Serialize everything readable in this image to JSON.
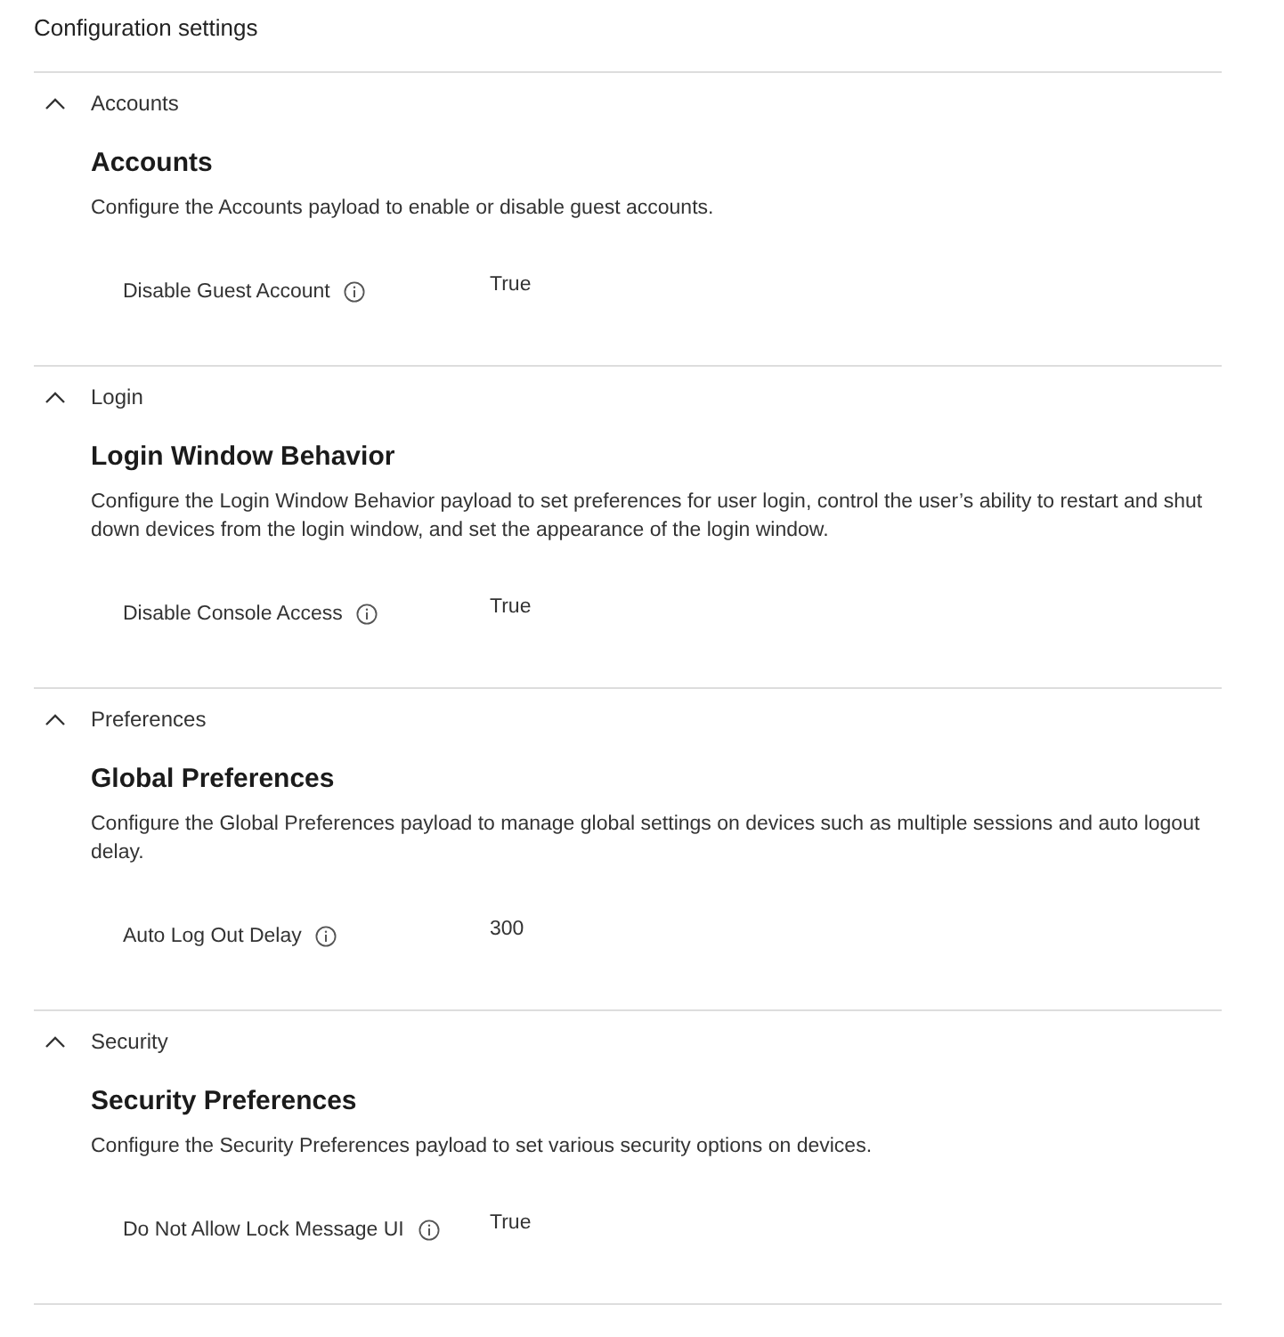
{
  "title": "Configuration settings",
  "sections": [
    {
      "header": "Accounts",
      "expanded": true,
      "heading": "Accounts",
      "description": "Configure the Accounts payload to enable or disable guest accounts.",
      "settings": [
        {
          "label": "Disable Guest Account",
          "value": "True"
        }
      ]
    },
    {
      "header": "Login",
      "expanded": true,
      "heading": "Login Window Behavior",
      "description": "Configure the Login Window Behavior payload to set preferences for user login, control the user’s ability to restart and shut down devices from the login window, and set the appearance of the login window.",
      "settings": [
        {
          "label": "Disable Console Access",
          "value": "True"
        }
      ]
    },
    {
      "header": "Preferences",
      "expanded": true,
      "heading": "Global Preferences",
      "description": "Configure the Global Preferences payload to manage global settings on devices such as multiple sessions and auto logout delay.",
      "settings": [
        {
          "label": "Auto Log Out Delay",
          "value": "300"
        }
      ]
    },
    {
      "header": "Security",
      "expanded": true,
      "heading": "Security Preferences",
      "description": "Configure the Security Preferences payload to set various security options on devices.",
      "settings": [
        {
          "label": "Do Not Allow Lock Message UI",
          "value": "True"
        }
      ]
    }
  ]
}
